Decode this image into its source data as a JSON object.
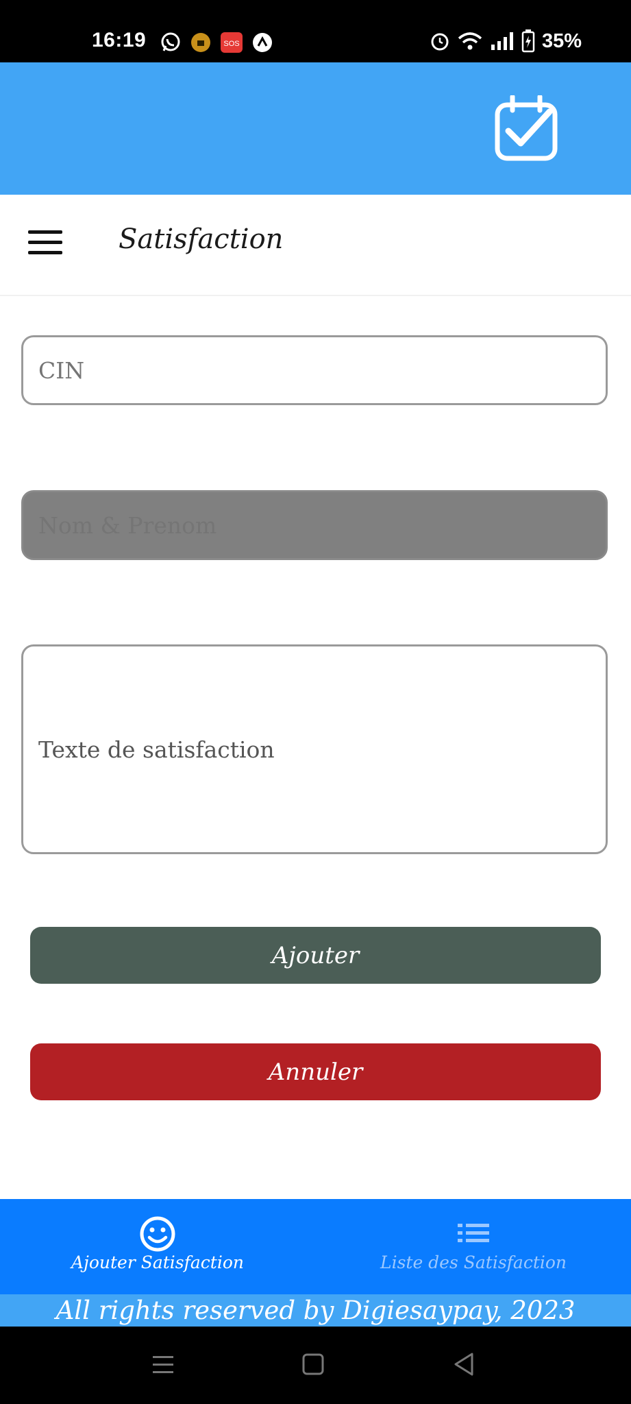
{
  "status_bar": {
    "time": "16:19",
    "left_icons": [
      "whatsapp-icon",
      "lock-app-icon",
      "sos-icon",
      "nav-arrow-icon"
    ],
    "sos_label": "SOS",
    "right_icons": [
      "alarm-icon",
      "wifi-icon",
      "signal-icon",
      "battery-icon"
    ],
    "battery": "35%"
  },
  "app_bar": {
    "logo_icon": "calendar-check-icon"
  },
  "title_bar": {
    "menu_icon": "hamburger-menu-icon",
    "title": "Satisfaction"
  },
  "form": {
    "cin_placeholder": "CIN",
    "nom_placeholder": "Nom & Prenom",
    "texte_placeholder": "Texte de satisfaction"
  },
  "buttons": {
    "ajouter": "Ajouter",
    "annuler": "Annuler"
  },
  "bottom_nav": {
    "items": [
      {
        "label": "Ajouter Satisfaction",
        "icon": "smiley-icon",
        "active": true
      },
      {
        "label": "Liste des Satisfaction",
        "icon": "list-icon",
        "active": false
      }
    ]
  },
  "footer": {
    "text": "All rights reserved by Digiesaypay, 2023"
  },
  "colors": {
    "app_bar": "#42a5f5",
    "bottom_nav": "#0a7cff",
    "ajouter_button": "#4b5e56",
    "annuler_button": "#b32024",
    "disabled_field": "#808080"
  }
}
